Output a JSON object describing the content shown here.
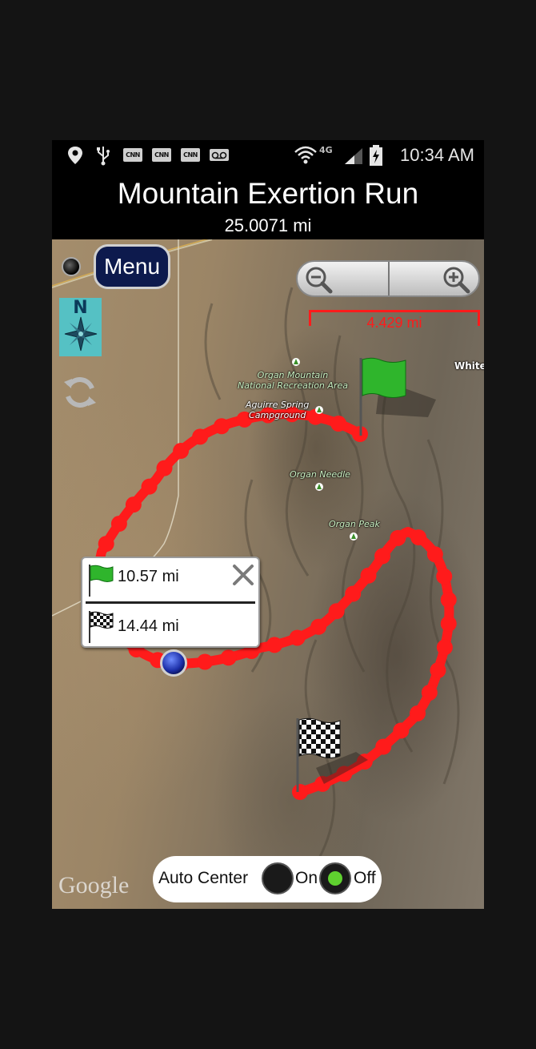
{
  "status_bar": {
    "time": "10:34 AM",
    "network": "4G",
    "notification_icons": [
      "location-icon",
      "usb-icon",
      "cnn-icon",
      "cnn-icon",
      "cnn-icon",
      "voicemail-icon"
    ],
    "cnn_text": "CNN",
    "system_icons": [
      "wifi-icon",
      "signal-icon",
      "battery-charging-icon"
    ]
  },
  "header": {
    "title": "Mountain Exertion Run",
    "distance": "25.0071 mi"
  },
  "map": {
    "menu_label": "Menu",
    "compass_letter": "N",
    "scale_label": "4.429 mi",
    "route_color": "#ff1b1b",
    "labels": {
      "organ_mountain": "Organ Mountain\nNational Recreation Area",
      "aguirre_spring": "Aguirre Spring\nCampground",
      "organ_needle": "Organ Needle",
      "organ_peak": "Organ Peak",
      "white": "White"
    },
    "attribution": "Google"
  },
  "popup": {
    "start_distance": "10.57 mi",
    "finish_distance": "14.44 mi"
  },
  "auto_center": {
    "label": "Auto Center",
    "on_label": "On",
    "off_label": "Off",
    "selected": "Off",
    "selected_color": "#5fd12f"
  }
}
